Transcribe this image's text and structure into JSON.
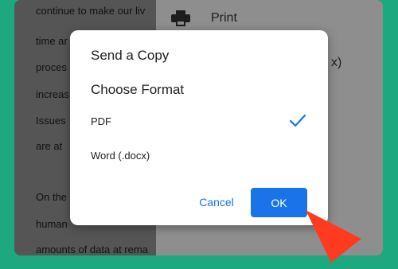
{
  "document": {
    "lines": [
      "continue to make our liv",
      "time ar",
      "proces",
      "increas",
      "Issues",
      "are at ",
      "On the",
      "human",
      "amounts of data at rema"
    ]
  },
  "menu": {
    "print_label": "Print",
    "print_icon": "print-icon",
    "partial_text": "x)"
  },
  "dialog": {
    "title": "Send a Copy",
    "subtitle": "Choose Format",
    "options": [
      {
        "label": "PDF",
        "selected": true
      },
      {
        "label": "Word (.docx)",
        "selected": false
      }
    ],
    "cancel_label": "Cancel",
    "ok_label": "OK"
  },
  "colors": {
    "background": "#1ea880",
    "accent": "#1a73e8",
    "annotation_arrow": "#ff3b1f"
  }
}
